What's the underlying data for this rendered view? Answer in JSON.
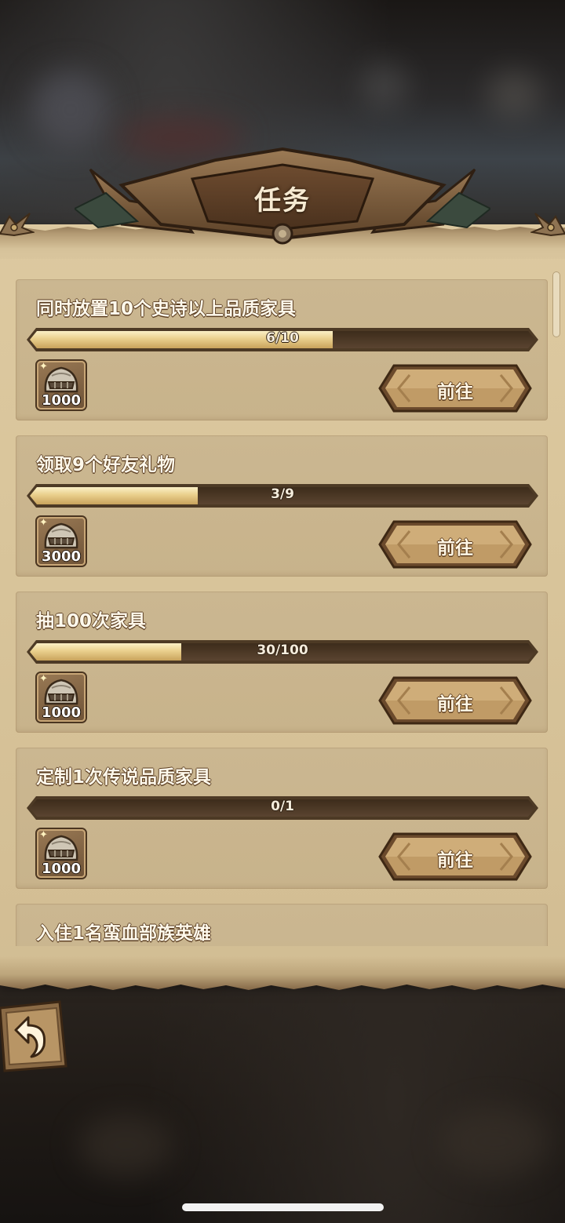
{
  "header": {
    "title": "任务"
  },
  "tasks": [
    {
      "title": "同时放置10个史诗以上品质家具",
      "progress_text": "6/10",
      "progress": 0.6,
      "reward_qty": "1000",
      "button_label": "前往"
    },
    {
      "title": "领取9个好友礼物",
      "progress_text": "3/9",
      "progress": 0.333,
      "reward_qty": "3000",
      "button_label": "前往"
    },
    {
      "title": "抽100次家具",
      "progress_text": "30/100",
      "progress": 0.3,
      "reward_qty": "1000",
      "button_label": "前往"
    },
    {
      "title": "定制1次传说品质家具",
      "progress_text": "0/1",
      "progress": 0.0,
      "reward_qty": "1000",
      "button_label": "前往"
    },
    {
      "title": "入住1名蛮血部族英雄"
    }
  ],
  "icons": {
    "reward": "helmet-icon",
    "back": "back-arrow-icon"
  },
  "colors": {
    "progress_fill": "#e9cf8c",
    "panel": "#d9c59b",
    "button": "#b8935f"
  }
}
